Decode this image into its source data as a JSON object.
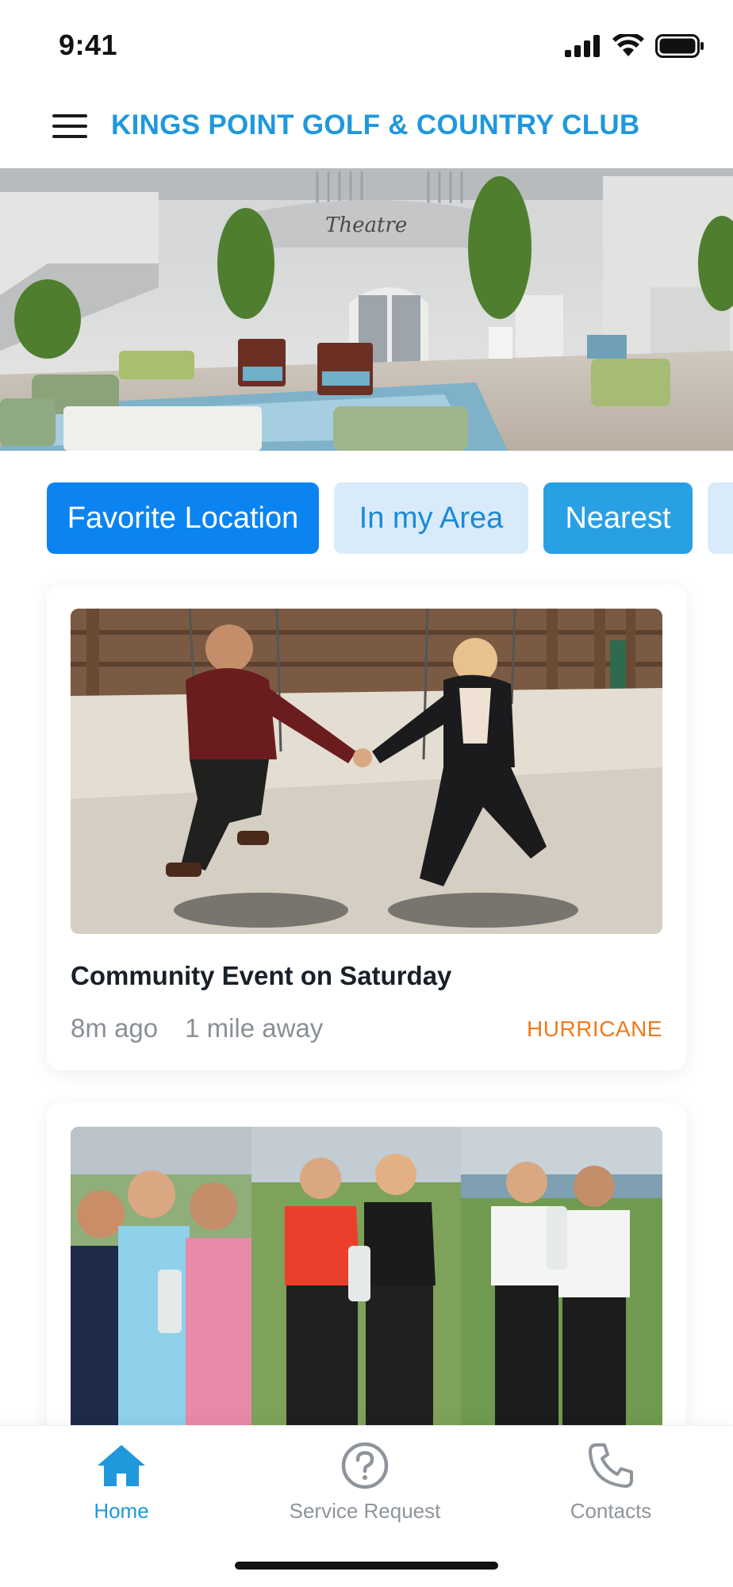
{
  "status_bar": {
    "time": "9:41",
    "icons": [
      "cellular-signal-icon",
      "wifi-icon",
      "battery-icon"
    ]
  },
  "header": {
    "title": "KINGS POINT GOLF & COUNTRY CLUB",
    "menu_icon": "hamburger-menu-icon"
  },
  "hero": {
    "signage_text": "Theatre"
  },
  "filters": [
    {
      "label": "Favorite Location",
      "selected": true
    },
    {
      "label": "In my Area",
      "selected": false
    },
    {
      "label": "Nearest",
      "selected": false
    },
    {
      "label": "",
      "selected": false
    }
  ],
  "feed": [
    {
      "title": "Community Event on Saturday",
      "time_ago": "8m ago",
      "distance": "1 mile away",
      "tag": "HURRICANE"
    },
    {
      "title": "",
      "time_ago": "",
      "distance": "",
      "tag": ""
    }
  ],
  "tab_bar": {
    "items": [
      {
        "label": "Home",
        "icon": "home-icon",
        "active": true
      },
      {
        "label": "Service Request",
        "icon": "question-circle-icon",
        "active": false
      },
      {
        "label": "Contacts",
        "icon": "phone-icon",
        "active": false
      }
    ]
  },
  "colors": {
    "brand": "#1f98dc",
    "primary_chip": "#0b84f2",
    "secondary_chip": "#d9ebfa",
    "accent_chip": "#2aa0e4",
    "tag": "#f07a1a"
  }
}
